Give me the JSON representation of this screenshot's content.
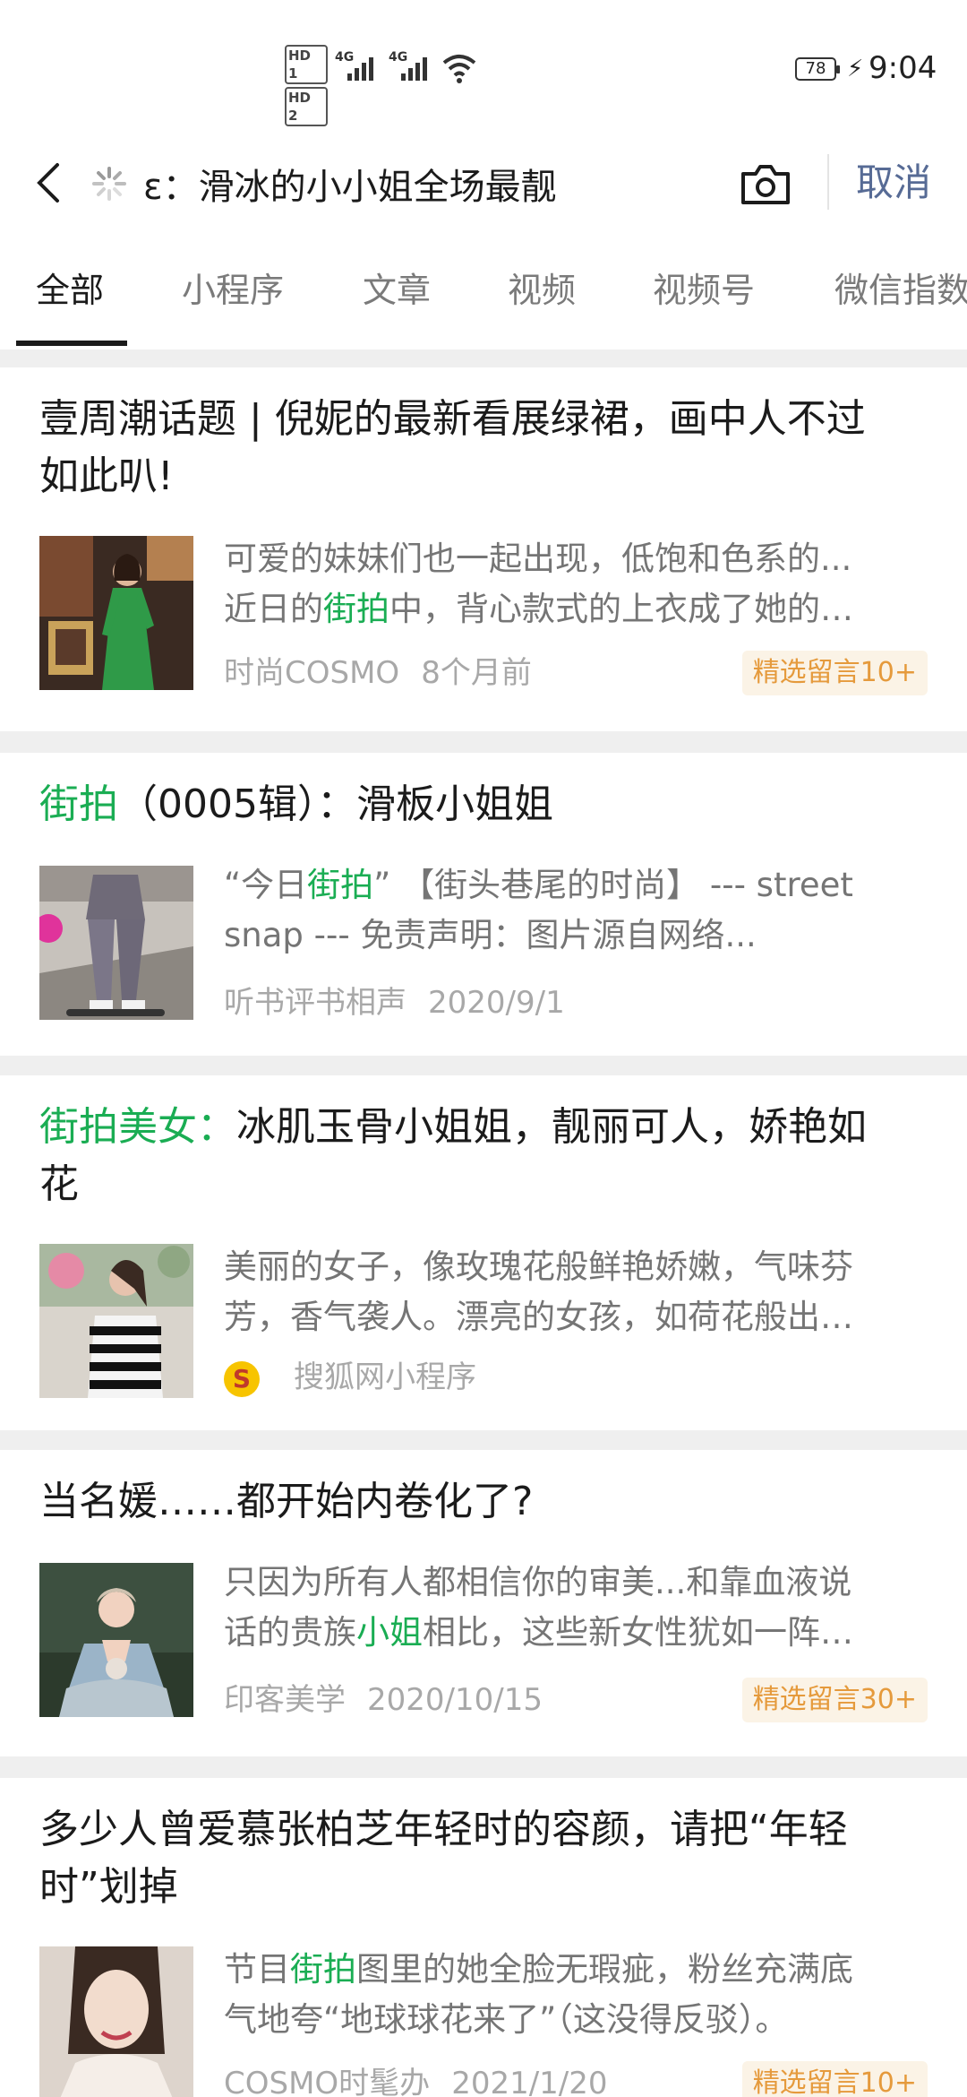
{
  "status_bar": {
    "hd1": "HD 1",
    "hd2": "HD 2",
    "net1": "4G",
    "net2": "4G",
    "battery": "78",
    "time": "9:04"
  },
  "search": {
    "query": "ɛ：滑冰的小小姐全场最靓",
    "cancel_label": "取消"
  },
  "tabs": [
    "全部",
    "小程序",
    "文章",
    "视频",
    "视频号",
    "微信指数"
  ],
  "colors": {
    "highlight": "#1aad53",
    "link_blue": "#576b95",
    "badge_text": "#e59a3c"
  },
  "results": [
    {
      "title_hl": "",
      "title_rest_line1": "壹周潮话题 | 倪妮的最新看展绿裙，画中人不过",
      "title_rest_line2": "如此叭!",
      "snippet_line1": "可爱的妹妹们也一起出现，低饱和色系的...",
      "snippet_line2_pre": "近日的",
      "snippet_line2_hl": "街拍",
      "snippet_line2_post": "中，背心款式的上衣成了她的…",
      "source": "时尚COSMO",
      "time": "8个月前",
      "badge": "精选留言10+"
    },
    {
      "title_hl": "街拍",
      "title_rest_line1": "（0005辑）：滑板小姐姐",
      "snippet_line1_pre": "“今日",
      "snippet_line1_hl": "街拍",
      "snippet_line1_post": "” 【街头巷尾的时尚】 --- street",
      "snippet_line2": "snap --- 免责声明：图片源自网络...",
      "source": "听书评书相声",
      "time": "2020/9/1"
    },
    {
      "title_hl": "街拍美女：",
      "title_rest_line1": "冰肌玉骨小姐姐，靓丽可人，娇艳如",
      "title_rest_line2": "花",
      "snippet_line1": "美丽的女子，像玫瑰花般鲜艳娇嫩，气味芬",
      "snippet_line2": "芳，香气袭人。漂亮的女孩，如荷花般出…",
      "source_icon": "sohu-icon",
      "source": "搜狐网小程序"
    },
    {
      "title_rest_line1": "当名媛……都开始内卷化了?",
      "snippet_line1": "只因为所有人都相信你的审美...和靠血液说",
      "snippet_line2_pre": "话的贵族",
      "snippet_line2_hl": "小姐",
      "snippet_line2_post": "相比，这些新女性犹如一阵…",
      "source": "印客美学",
      "time": "2020/10/15",
      "badge": "精选留言30+"
    },
    {
      "title_rest_line1": "多少人曾爱慕张柏芝年轻时的容颜，请把“年轻",
      "title_rest_line2": "时”划掉",
      "snippet_line1_pre": "节目",
      "snippet_line1_hl": "街拍",
      "snippet_line1_post": "图里的她全脸无瑕疵，粉丝充满底",
      "snippet_line2": "气地夸“地球球花来了”（这没得反驳）。",
      "source": "COSMO时髦办",
      "time": "2021/1/20",
      "badge": "精选留言10+"
    }
  ]
}
